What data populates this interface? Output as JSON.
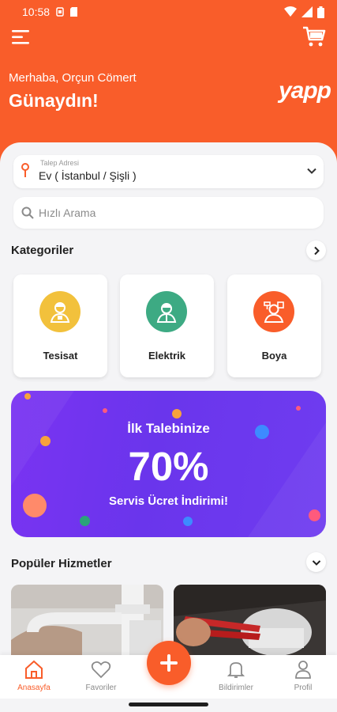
{
  "status_bar": {
    "time": "10:58"
  },
  "header": {
    "greeting": "Merhaba, Orçun Cömert",
    "salutation": "Günaydın!",
    "logo_text": "yapp"
  },
  "address": {
    "label": "Talep Adresi",
    "value": "Ev ( İstanbul / Şişli )"
  },
  "search": {
    "placeholder": "Hızlı Arama"
  },
  "categories": {
    "title": "Kategoriler",
    "items": [
      {
        "label": "Tesisat",
        "color": "#f2c13c",
        "icon": "plumber-icon"
      },
      {
        "label": "Elektrik",
        "color": "#3daa83",
        "icon": "electrician-icon"
      },
      {
        "label": "Boya",
        "color": "#f95d2a",
        "icon": "painter-icon"
      }
    ]
  },
  "promo": {
    "line1": "İlk Talebinize",
    "line2": "70%",
    "line3": "Servis Ücret İndirimi!"
  },
  "popular": {
    "title": "Popüler Hizmetler"
  },
  "bottom_nav": {
    "items": [
      {
        "label": "Anasayfa",
        "icon": "home-icon",
        "active": true
      },
      {
        "label": "Favoriler",
        "icon": "heart-icon",
        "active": false
      },
      {
        "label": "Bildirimler",
        "icon": "bell-icon",
        "active": false
      },
      {
        "label": "Profil",
        "icon": "person-icon",
        "active": false
      }
    ]
  },
  "colors": {
    "brand": "#f95d2a",
    "promo_purple": "#6f3cf0"
  }
}
